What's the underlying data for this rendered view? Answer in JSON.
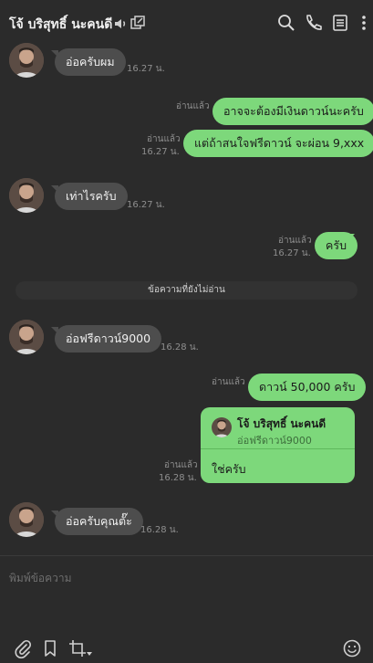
{
  "header": {
    "title": "โจ้ บริสุทธิ์ นะคนดี",
    "icons": [
      "speaker-icon",
      "external-window-icon",
      "search-icon",
      "phone-icon",
      "notes-icon",
      "more-icon"
    ]
  },
  "messages": [
    {
      "dir": "in",
      "text": "อ่อครับผม",
      "time": "16.27 น."
    },
    {
      "dir": "out",
      "text": "อาจจะต้องมีเงินดาวน์นะครับ",
      "read": "อ่านแล้ว"
    },
    {
      "dir": "out",
      "text": "แต่ถ้าสนใจฟรีดาวน์ จะผ่อน 9,xxx",
      "read": "อ่านแล้ว",
      "time": "16.27 น."
    },
    {
      "dir": "in",
      "text": "เท่าไรครับ",
      "time": "16.27 น."
    },
    {
      "dir": "out",
      "text": "ครับ",
      "read": "อ่านแล้ว",
      "time": "16.27 น."
    },
    {
      "dir": "in",
      "text": "อ่อฟรีดาวน์9000",
      "time": "16.28 น."
    },
    {
      "dir": "out",
      "text": "ดาวน์ 50,000 ครับ",
      "read": "อ่านแล้ว"
    },
    {
      "dir": "out",
      "reply": {
        "name": "โจ้ บริสุทธิ์ นะคนดี",
        "quoted": "อ่อฟรีดาวน์9000"
      },
      "text": "ใช่ครับ",
      "read": "อ่านแล้ว",
      "time": "16.28 น."
    },
    {
      "dir": "in",
      "text": "อ่อครับคุณตั๊ะ",
      "time": "16.28 น."
    }
  ],
  "divider": "ข้อความที่ยังไม่อ่าน",
  "input": {
    "placeholder": "พิมพ์ข้อความ"
  },
  "footer_icons": [
    "paperclip-icon",
    "bookmark-icon",
    "crop-icon",
    "emoji-icon"
  ],
  "colors": {
    "background": "#2b2b2b",
    "outgoing": "#7dd87b",
    "incoming": "#4d4d4d"
  }
}
